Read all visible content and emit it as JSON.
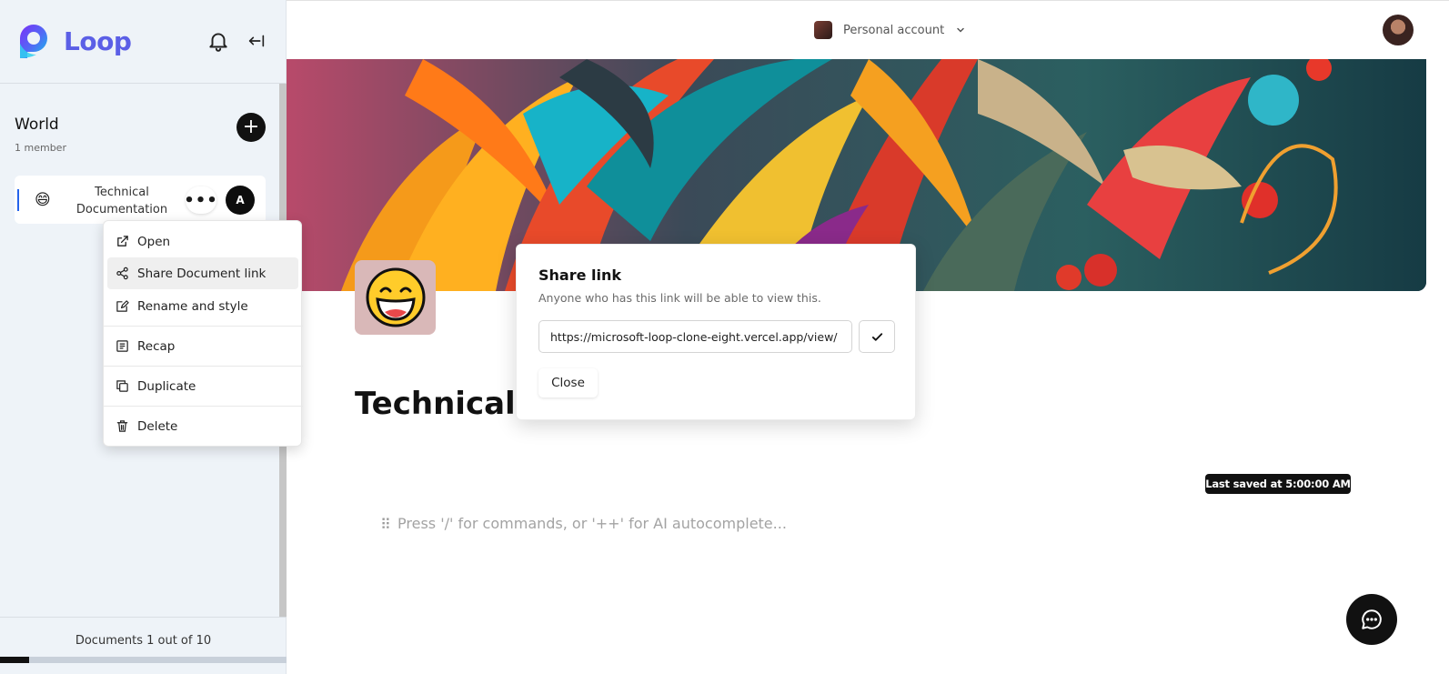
{
  "app": {
    "name": "Loop"
  },
  "sidebar": {
    "workspace_title": "World",
    "workspace_members": "1 member",
    "documents": [
      {
        "emoji": "😄",
        "name": "Technical Documentation",
        "avatar": "A"
      }
    ],
    "footer": "Documents 1 out of 10",
    "documents_used_fraction": 0.1
  },
  "context_menu": {
    "items": [
      {
        "label": "Open",
        "icon": "external-link-icon"
      },
      {
        "label": "Share Document link",
        "icon": "share-icon"
      },
      {
        "label": "Rename and style",
        "icon": "edit-icon"
      },
      {
        "label": "Recap",
        "icon": "recap-icon"
      },
      {
        "label": "Duplicate",
        "icon": "copy-icon"
      },
      {
        "label": "Delete",
        "icon": "trash-icon"
      }
    ],
    "highlighted": "Share Document link"
  },
  "topbar": {
    "account_label": "Personal account"
  },
  "document": {
    "title": "Technical Documentation",
    "icon_emoji": "😄",
    "last_saved": "Last saved at 5:00:00 AM",
    "editor_placeholder": "Press '/' for commands, or '++' for AI autocomplete..."
  },
  "share_dialog": {
    "title": "Share link",
    "description": "Anyone who has this link will be able to view this.",
    "link": "https://microsoft-loop-clone-eight.vercel.app/view/",
    "close_label": "Close"
  },
  "colors": {
    "brand": "#5b5fe6",
    "accent": "#2463eb",
    "dark": "#111111"
  }
}
